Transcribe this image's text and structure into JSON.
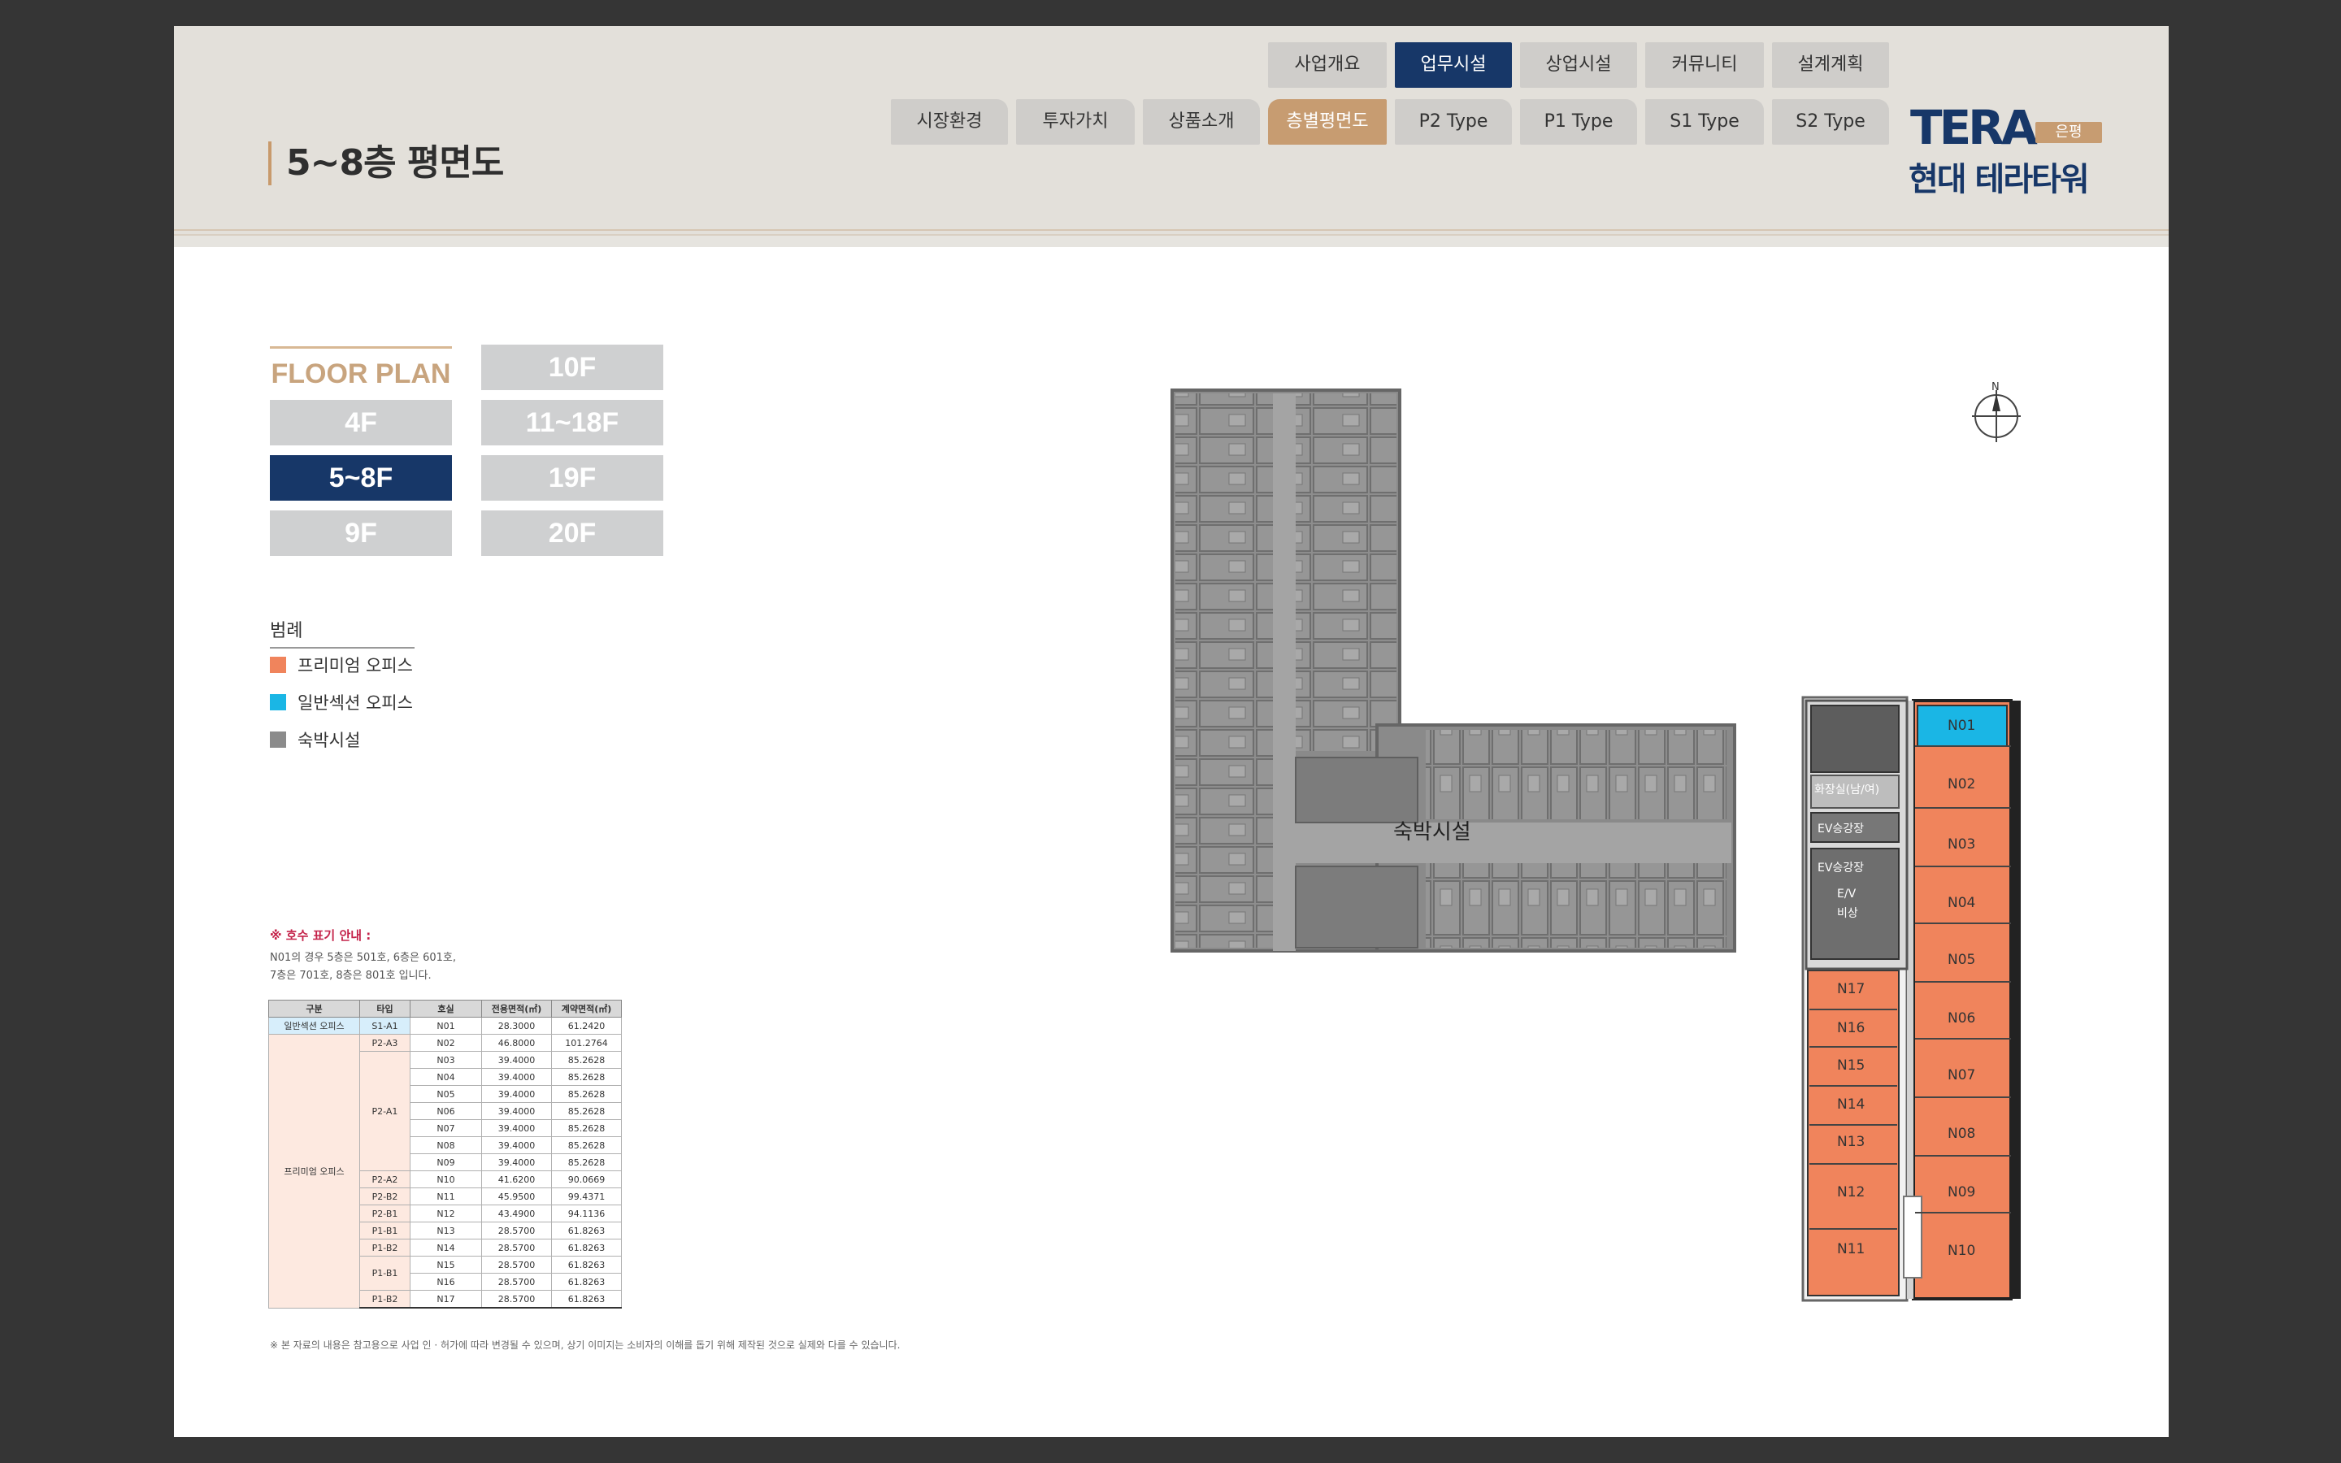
{
  "header": {
    "page_title": "5~8층 평면도",
    "nav_primary": [
      "사업개요",
      "업무시설",
      "상업시설",
      "커뮤니티",
      "설계계획"
    ],
    "nav_secondary": [
      "시장환경",
      "투자가치",
      "상품소개",
      "층별평면도",
      "P2 Type",
      "P1 Type",
      "S1 Type",
      "S2 Type"
    ],
    "active_primary": "업무시설",
    "active_secondary": "층별평면도",
    "logo": {
      "brand": "TERA",
      "badge": "은평",
      "name": "현대 테라타워"
    },
    "colors": {
      "navy": "#173768",
      "tan": "#c79c71"
    }
  },
  "floor_plan": {
    "title": "FLOOR PLAN",
    "buttons": [
      "4F",
      "5~8F",
      "9F",
      "10F",
      "11~18F",
      "19F",
      "20F"
    ],
    "active": "5~8F"
  },
  "legend": {
    "title": "범례",
    "items": [
      {
        "label": "프리미엄 오피스",
        "color": "#f0845c"
      },
      {
        "label": "일반섹션 오피스",
        "color": "#1ab6e5"
      },
      {
        "label": "숙박시설",
        "color": "#8b8b8b"
      }
    ]
  },
  "note": {
    "title": "※ 호수 표기 안내 :",
    "lines": [
      "N01의 경우 5층은 501호, 6층은 601호,",
      "7층은 701호, 8층은 801호 입니다."
    ]
  },
  "unit_table": {
    "headers": [
      "구분",
      "타입",
      "호실",
      "전용면적(㎡)",
      "계약면적(㎡)"
    ],
    "category_general": "일반섹션 오피스",
    "category_premium": "프리미엄 오피스",
    "rows": [
      {
        "type": "S1-A1",
        "unit": "N01",
        "exclusive": "28.3000",
        "contract": "61.2420"
      },
      {
        "type": "P2-A3",
        "unit": "N02",
        "exclusive": "46.8000",
        "contract": "101.2764"
      },
      {
        "type": "P2-A1",
        "unit": "N03",
        "exclusive": "39.4000",
        "contract": "85.2628"
      },
      {
        "type": "",
        "unit": "N04",
        "exclusive": "39.4000",
        "contract": "85.2628"
      },
      {
        "type": "",
        "unit": "N05",
        "exclusive": "39.4000",
        "contract": "85.2628"
      },
      {
        "type": "",
        "unit": "N06",
        "exclusive": "39.4000",
        "contract": "85.2628"
      },
      {
        "type": "",
        "unit": "N07",
        "exclusive": "39.4000",
        "contract": "85.2628"
      },
      {
        "type": "",
        "unit": "N08",
        "exclusive": "39.4000",
        "contract": "85.2628"
      },
      {
        "type": "",
        "unit": "N09",
        "exclusive": "39.4000",
        "contract": "85.2628"
      },
      {
        "type": "P2-A2",
        "unit": "N10",
        "exclusive": "41.6200",
        "contract": "90.0669"
      },
      {
        "type": "P2-B2",
        "unit": "N11",
        "exclusive": "45.9500",
        "contract": "99.4371"
      },
      {
        "type": "P2-B1",
        "unit": "N12",
        "exclusive": "43.4900",
        "contract": "94.1136"
      },
      {
        "type": "P1-B1",
        "unit": "N13",
        "exclusive": "28.5700",
        "contract": "61.8263"
      },
      {
        "type": "P1-B2",
        "unit": "N14",
        "exclusive": "28.5700",
        "contract": "61.8263"
      },
      {
        "type": "P1-B1",
        "unit": "N15",
        "exclusive": "28.5700",
        "contract": "61.8263"
      },
      {
        "type": "",
        "unit": "N16",
        "exclusive": "28.5700",
        "contract": "61.8263"
      },
      {
        "type": "P1-B2",
        "unit": "N17",
        "exclusive": "28.5700",
        "contract": "61.8263"
      }
    ]
  },
  "disclaimer": "※ 본 자료의 내용은 참고용으로 사업 인 · 허가에 따라 변경될 수 있으며, 상기 이미지는 소비자의 이해를 돕기 위해 제작된 것으로 실제와 다를 수 있습니다.",
  "plan": {
    "hotel_label": "숙박시설",
    "core_labels": [
      "화장실(남/여)",
      "EV승강장",
      "EV승강장",
      "E/V",
      "비상"
    ],
    "compass": "N",
    "units_right": [
      "N01",
      "N02",
      "N03",
      "N04",
      "N05",
      "N06",
      "N07",
      "N08",
      "N09",
      "N10"
    ],
    "units_left": [
      "N17",
      "N16",
      "N15",
      "N14",
      "N13",
      "N12",
      "N11"
    ],
    "colors": {
      "premium": "#f0845c",
      "general": "#1ab6e5",
      "hotel": "#8b8b8b"
    }
  }
}
